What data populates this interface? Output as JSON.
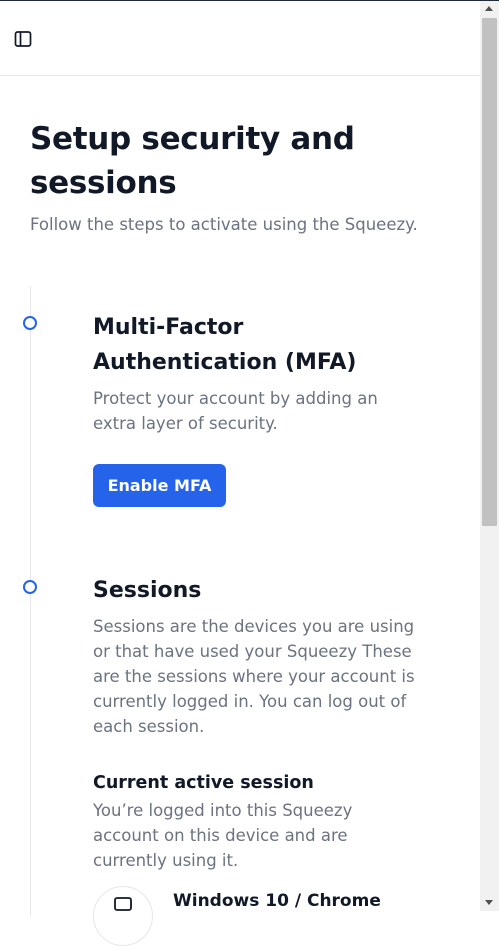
{
  "header": {
    "sidebar_toggle_icon": "sidebar-panel-icon"
  },
  "page": {
    "title": "Setup security and sessions",
    "subtitle": "Follow the steps to activate using the Squeezy."
  },
  "steps": [
    {
      "title": "Multi-Factor Authentication (MFA)",
      "description": "Protect your account by adding an extra layer of security.",
      "button_label": "Enable MFA"
    },
    {
      "title": "Sessions",
      "description": "Sessions are the devices you are using or that have used your Squeezy These are the sessions where your account is currently logged in. You can log out of each session.",
      "current_session": {
        "heading": "Current active session",
        "description": "You’re logged into this Squeezy account on this device and are currently using it.",
        "device_icon": "monitor-icon",
        "device_name": "Windows 10 / Chrome"
      }
    }
  ],
  "colors": {
    "accent": "#2563eb",
    "text_primary": "#111827",
    "text_secondary": "#6b7280",
    "border": "#e5e7eb"
  }
}
